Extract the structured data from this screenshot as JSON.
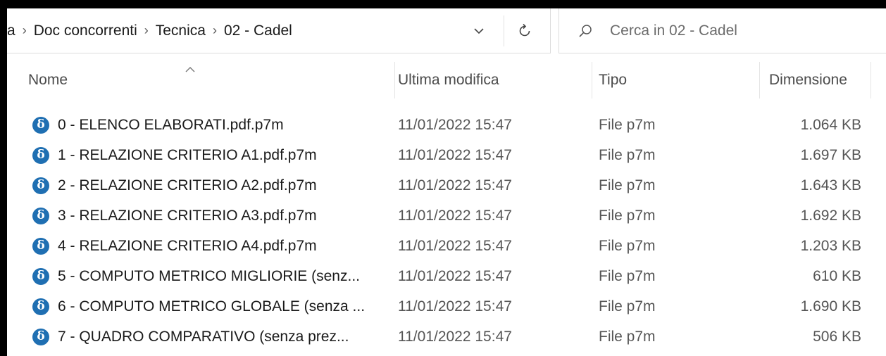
{
  "address_bar": {
    "crumbs": [
      "a",
      "Doc concorrenti",
      "Tecnica",
      "02 - Cadel"
    ],
    "separator": "›"
  },
  "search": {
    "placeholder": "Cerca in 02 - Cadel"
  },
  "columns": {
    "name": "Nome",
    "date": "Ultima modifica",
    "type": "Tipo",
    "size": "Dimensione"
  },
  "files": [
    {
      "name": "0 - ELENCO ELABORATI.pdf.p7m",
      "date": "11/01/2022 15:47",
      "type": "File p7m",
      "size": "1.064 KB"
    },
    {
      "name": "1 - RELAZIONE CRITERIO A1.pdf.p7m",
      "date": "11/01/2022 15:47",
      "type": "File p7m",
      "size": "1.697 KB"
    },
    {
      "name": "2 - RELAZIONE CRITERIO A2.pdf.p7m",
      "date": "11/01/2022 15:47",
      "type": "File p7m",
      "size": "1.643 KB"
    },
    {
      "name": "3 - RELAZIONE CRITERIO A3.pdf.p7m",
      "date": "11/01/2022 15:47",
      "type": "File p7m",
      "size": "1.692 KB"
    },
    {
      "name": "4 - RELAZIONE CRITERIO A4.pdf.p7m",
      "date": "11/01/2022 15:47",
      "type": "File p7m",
      "size": "1.203 KB"
    },
    {
      "name": "5 - COMPUTO METRICO MIGLIORIE (senz...",
      "date": "11/01/2022 15:47",
      "type": "File p7m",
      "size": "610 KB"
    },
    {
      "name": "6 - COMPUTO METRICO GLOBALE (senza ...",
      "date": "11/01/2022 15:47",
      "type": "File p7m",
      "size": "1.690 KB"
    },
    {
      "name": "7 - QUADRO COMPARATIVO (senza prez...",
      "date": "11/01/2022 15:47",
      "type": "File p7m",
      "size": "506 KB"
    }
  ],
  "icons": {
    "file": "p7m-signed-file-icon",
    "file_glyph": "δ",
    "file_color": "#1f6fb2"
  }
}
